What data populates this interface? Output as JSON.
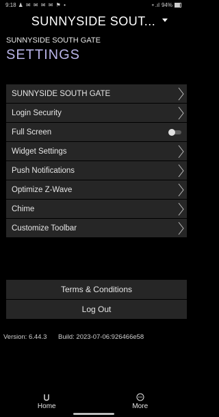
{
  "status_bar": {
    "time": "9:18",
    "notif_icons": "♟ ✉ ✉ ✉ ✉ ⚑ •",
    "signal": "⚬.ıl",
    "battery": "94%"
  },
  "header": {
    "title": "SUNNYSIDE SOUT..."
  },
  "subtitle": "SUNNYSIDE SOUTH GATE",
  "section_title": "SETTINGS",
  "menu": [
    {
      "label": "SUNNYSIDE SOUTH GATE",
      "kind": "chevron"
    },
    {
      "label": "Login Security",
      "kind": "chevron"
    },
    {
      "label": "Full Screen",
      "kind": "toggle"
    },
    {
      "label": "Widget Settings",
      "kind": "chevron"
    },
    {
      "label": "Push Notifications",
      "kind": "chevron"
    },
    {
      "label": "Optimize Z-Wave",
      "kind": "chevron"
    },
    {
      "label": "Chime",
      "kind": "chevron"
    },
    {
      "label": "Customize Toolbar",
      "kind": "chevron"
    }
  ],
  "buttons": {
    "terms": "Terms & Conditions",
    "logout": "Log Out"
  },
  "footer": {
    "version": "Version: 6.44.3",
    "build": "Build: 2023-07-06:926466e58"
  },
  "nav": {
    "home": "Home",
    "more": "More"
  },
  "colors": {
    "accent": "#b9b4e8",
    "row_bg": "#262626"
  }
}
